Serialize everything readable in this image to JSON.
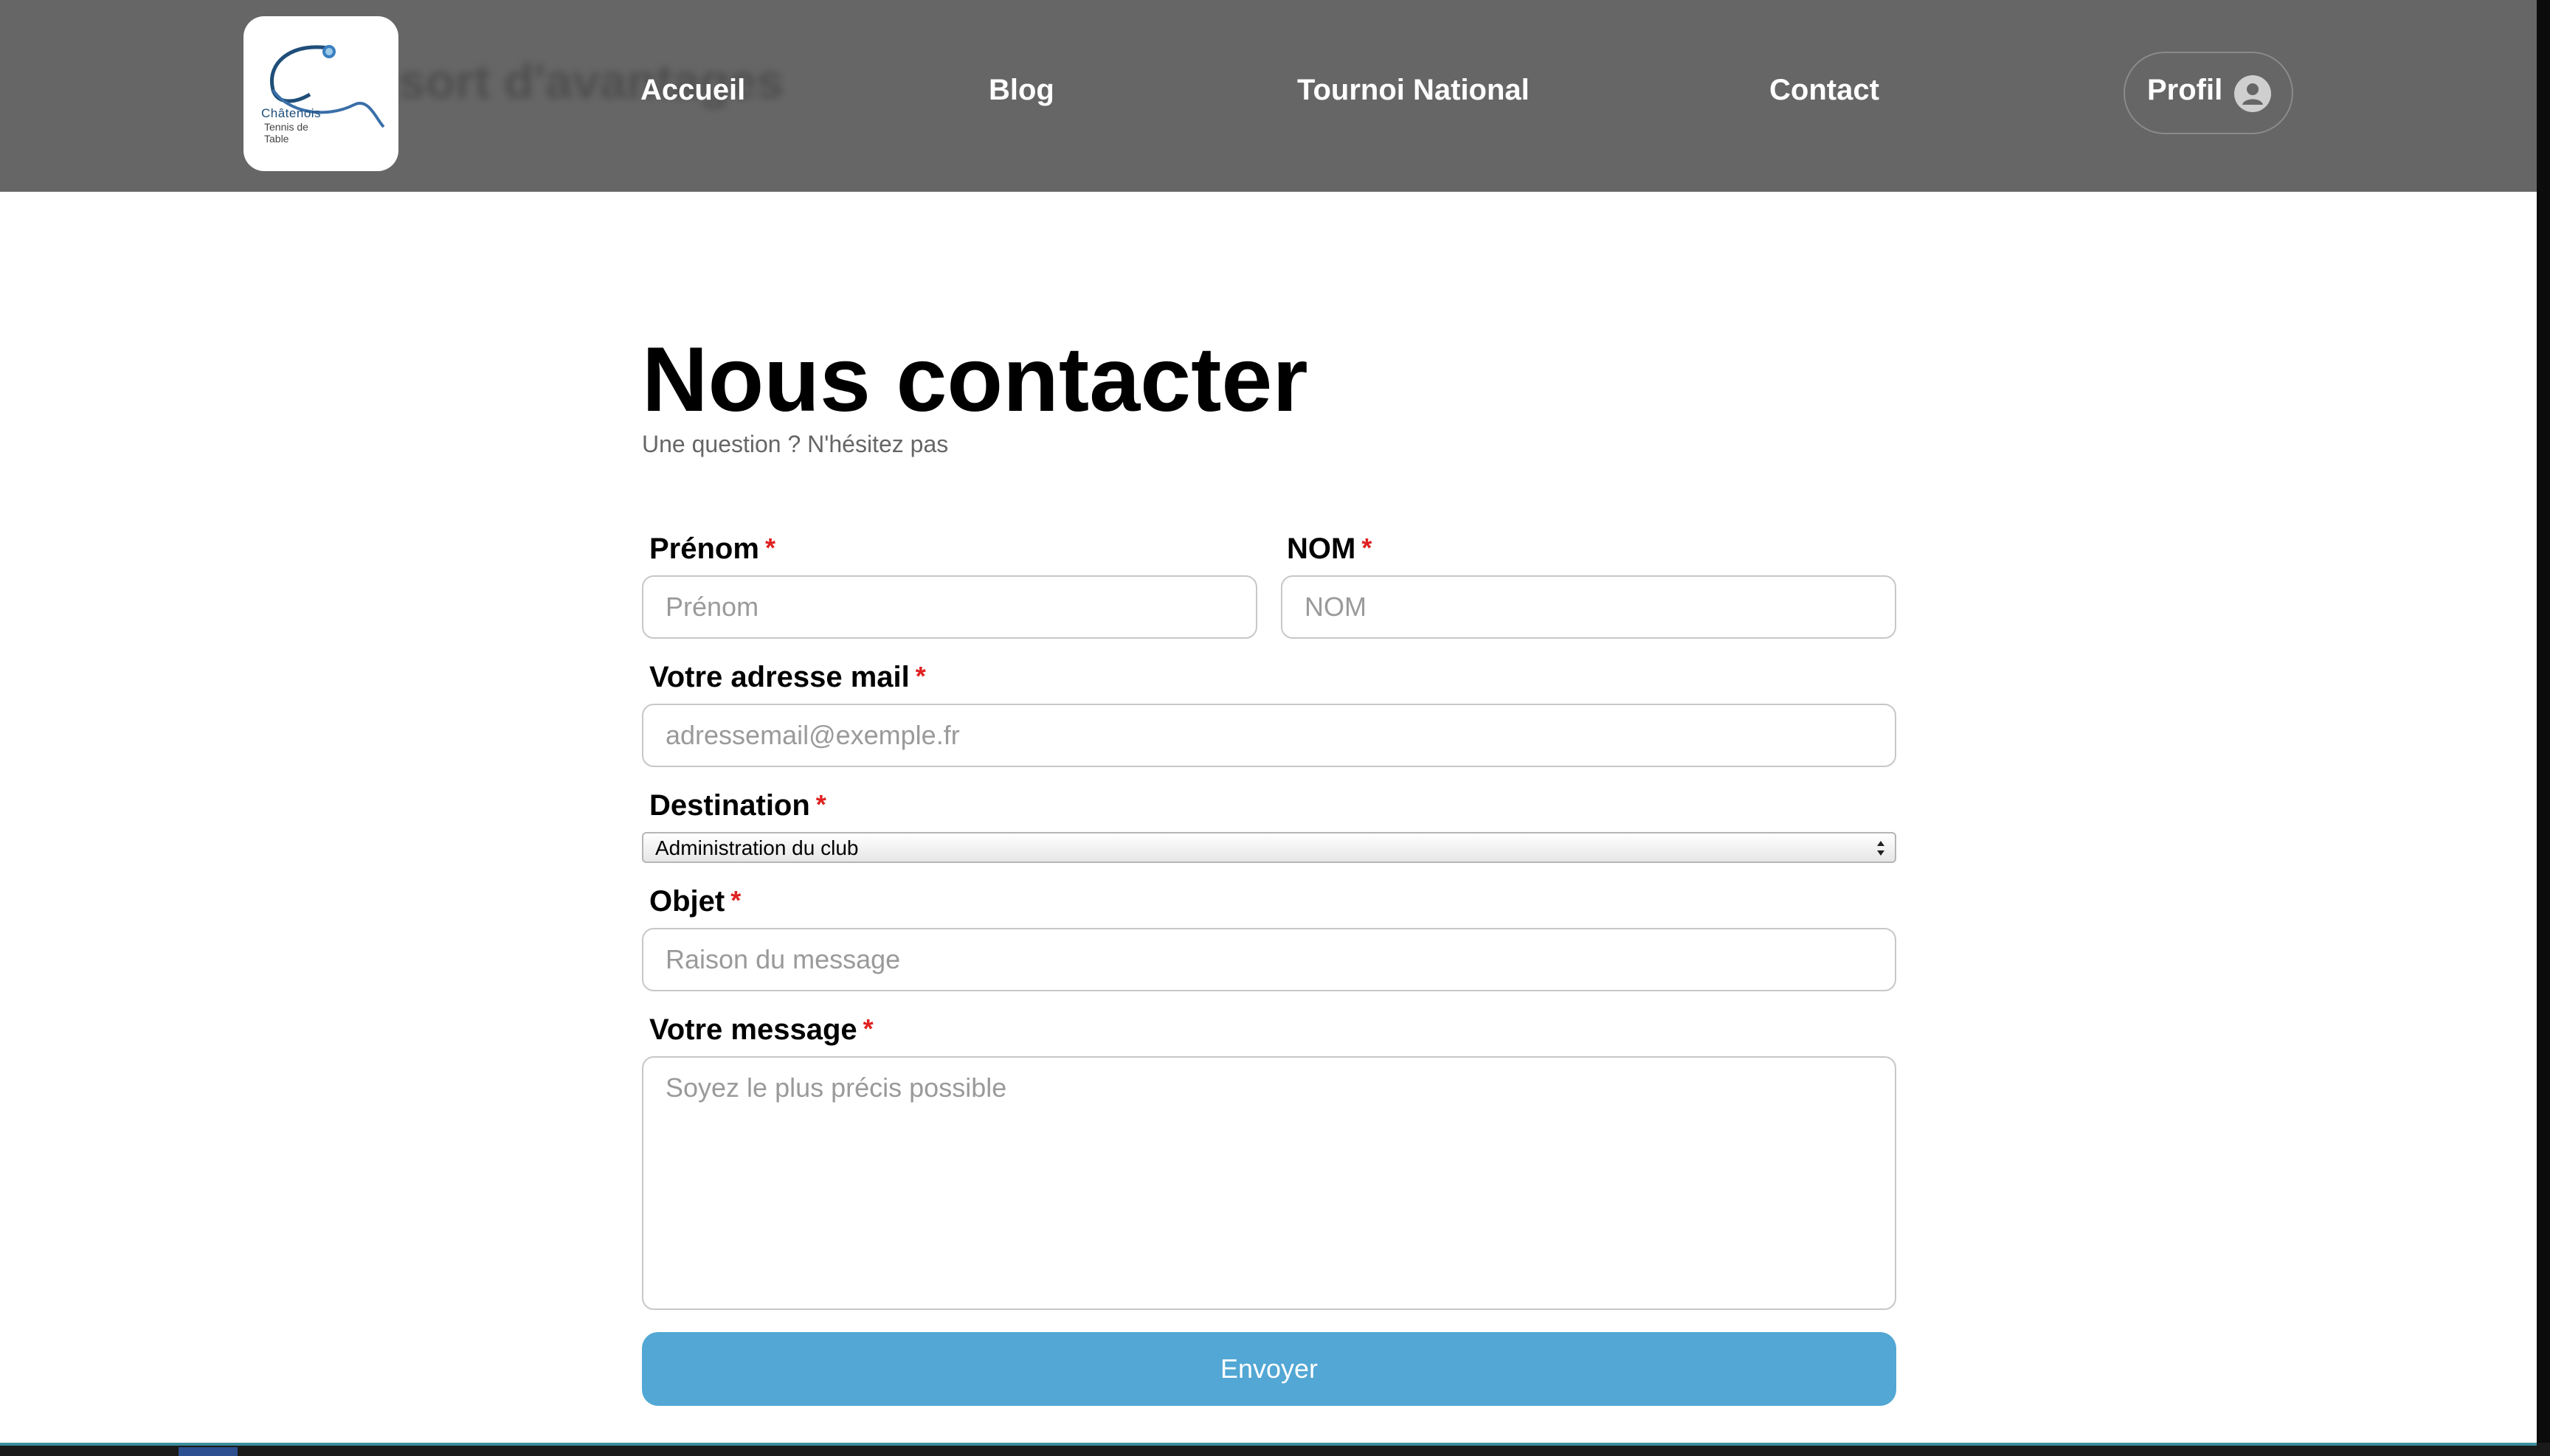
{
  "header": {
    "ghost_text": "sort d'avantages",
    "logo": {
      "name": "Châtenois",
      "line2": "Tennis de",
      "line3": "Table"
    },
    "nav": [
      {
        "label": "Accueil"
      },
      {
        "label": "Blog"
      },
      {
        "label": "Tournoi National"
      },
      {
        "label": "Contact"
      }
    ],
    "profil": {
      "label": "Profil",
      "icon": "user-avatar-icon"
    }
  },
  "main": {
    "title": "Nous contacter",
    "subtitle": "Une question ? N'hésitez pas",
    "form": {
      "required_marker": "*",
      "prenom": {
        "label": "Prénom",
        "placeholder": "Prénom",
        "value": ""
      },
      "nom": {
        "label": "NOM",
        "placeholder": "NOM",
        "value": ""
      },
      "email": {
        "label": "Votre adresse mail",
        "placeholder": "adressemail@exemple.fr",
        "value": ""
      },
      "destination": {
        "label": "Destination",
        "selected": "Administration du club"
      },
      "objet": {
        "label": "Objet",
        "placeholder": "Raison du message",
        "value": ""
      },
      "message": {
        "label": "Votre message",
        "placeholder": "Soyez le plus précis possible",
        "value": ""
      },
      "submit_label": "Envoyer"
    }
  },
  "colors": {
    "header_bg": "#666666",
    "accent_button": "#52a7d4",
    "required": "#e02020"
  }
}
